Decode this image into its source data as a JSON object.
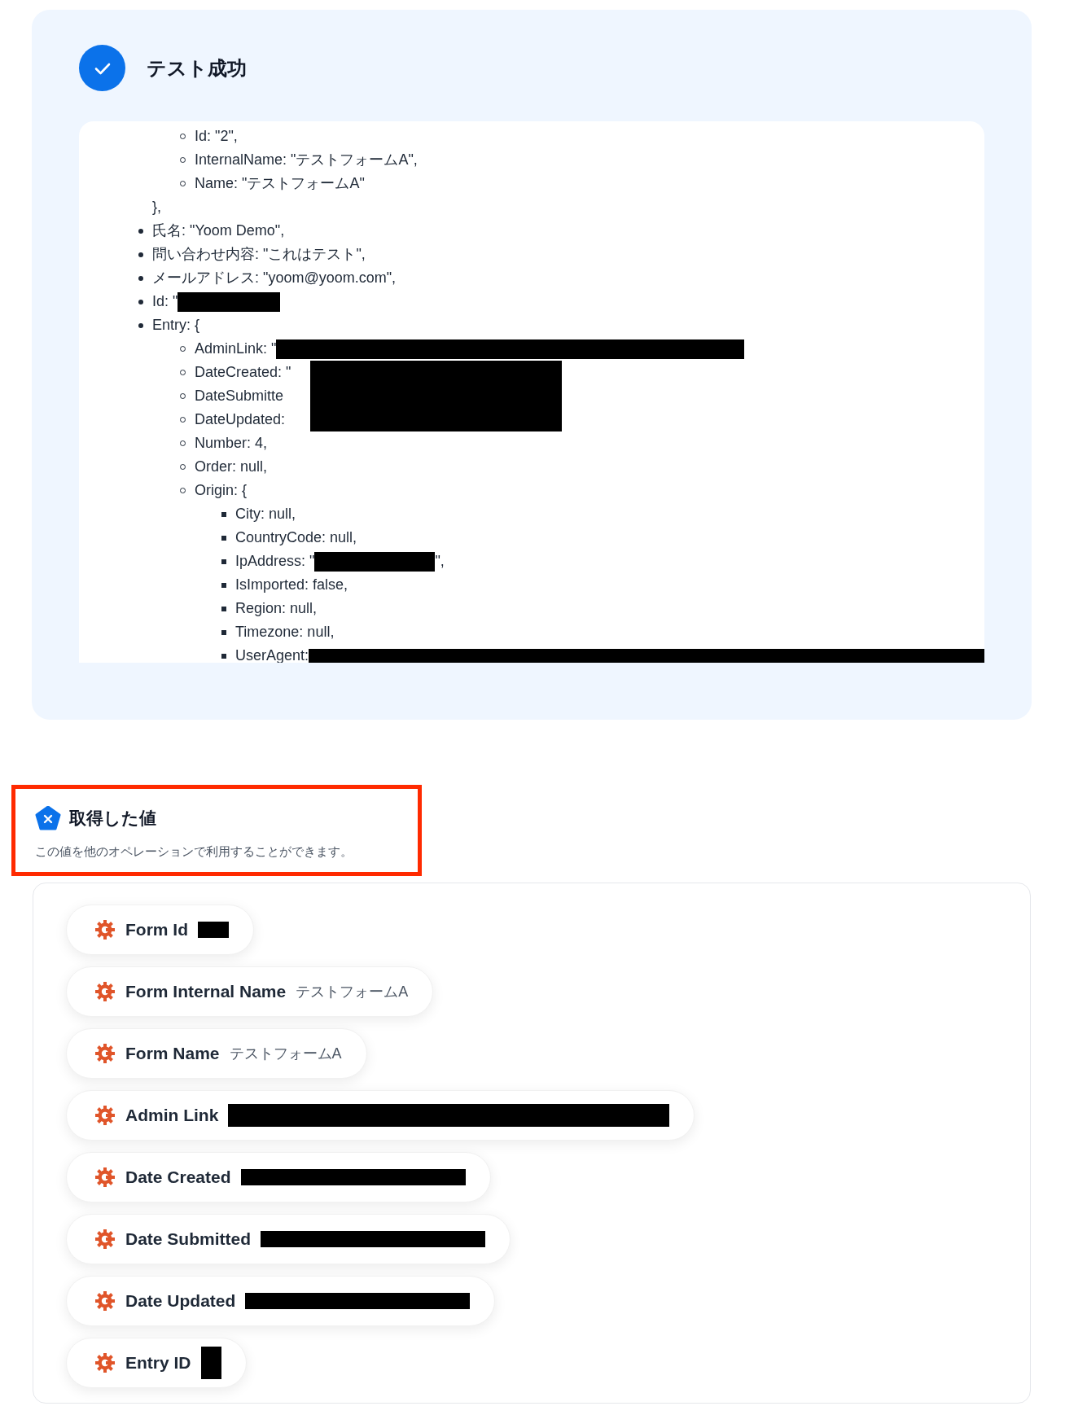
{
  "result_card": {
    "passed": true,
    "title": "テスト成功",
    "tree": [
      {
        "end": "},",
        "children": [
          {
            "text": "Id: \"2\","
          },
          {
            "text": "InternalName: \"テストフォームA\","
          },
          {
            "text": "Name: \"テストフォームA\""
          }
        ]
      },
      {
        "text": "氏名: \"Yoom Demo\","
      },
      {
        "text": "問い合わせ内容: \"これはテスト\","
      },
      {
        "text": "メールアドレス: \"yoom@yoom.com\","
      },
      {
        "text": "Id: \"",
        "redacted": true
      },
      {
        "text": "Entry: {",
        "children": [
          {
            "text": "AdminLink: \"",
            "redacted": true
          },
          {
            "text": "DateCreated: \"",
            "redacted": true
          },
          {
            "text": "DateSubmitte",
            "redacted": true
          },
          {
            "text": "DateUpdated:",
            "redacted": true
          },
          {
            "text": "Number: 4,"
          },
          {
            "text": "Order: null,"
          },
          {
            "text": "Origin: {",
            "children": [
              {
                "text": "City: null,"
              },
              {
                "text": "CountryCode: null,"
              },
              {
                "text": "IpAddress: \"",
                "redacted": true,
                "after": "\","
              },
              {
                "text": "IsImported: false,"
              },
              {
                "text": "Region: null,"
              },
              {
                "text": "Timezone: null,"
              },
              {
                "text": "UserAgent:",
                "redacted": true
              }
            ]
          }
        ]
      }
    ]
  },
  "values_section": {
    "title": "取得した値",
    "description": "この値を他のオペレーションで利用することができます。",
    "highlighted": true,
    "items": [
      {
        "label": "Form Id",
        "redacted": true
      },
      {
        "label": "Form Internal Name",
        "value": "テストフォームA"
      },
      {
        "label": "Form Name",
        "value": "テストフォームA"
      },
      {
        "label": "Admin Link",
        "redacted": true
      },
      {
        "label": "Date Created",
        "redacted": true
      },
      {
        "label": "Date Submitted",
        "redacted": true
      },
      {
        "label": "Date Updated",
        "redacted": true
      },
      {
        "label": "Entry ID",
        "redacted": true
      }
    ]
  }
}
